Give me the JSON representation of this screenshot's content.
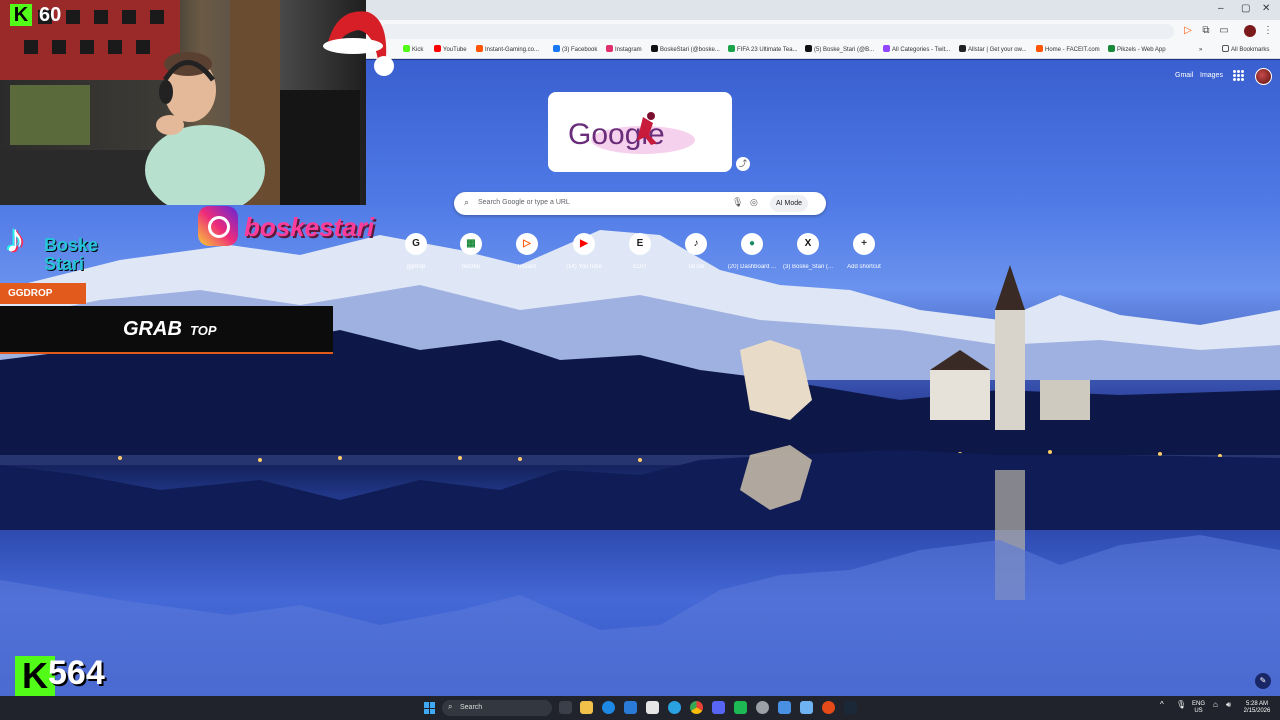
{
  "browser": {
    "bookmarks": [
      {
        "label": "Kick",
        "color": "#53fc18"
      },
      {
        "label": "YouTube",
        "color": "#ff0000"
      },
      {
        "label": "Instant-Gaming.co...",
        "color": "#ff5400"
      },
      {
        "label": "(3) Facebook",
        "color": "#1877f2"
      },
      {
        "label": "Instagram",
        "color": "#e1306c"
      },
      {
        "label": "BoskeStari (@boske...",
        "color": "#111111"
      },
      {
        "label": "FIFA 23 Ultimate Tea...",
        "color": "#1aa34a"
      },
      {
        "label": "(5) Boske_Stari (@B...",
        "color": "#111111"
      },
      {
        "label": "All Categories - Twit...",
        "color": "#9146ff"
      },
      {
        "label": "Allstar | Get your ow...",
        "color": "#222222"
      },
      {
        "label": "Home - FACEIT.com",
        "color": "#ff5500"
      },
      {
        "label": "Pikzels - Web App",
        "color": "#1a8a3a"
      }
    ],
    "all_bookmarks_label": "All Bookmarks"
  },
  "ntp": {
    "gmail_label": "Gmail",
    "images_label": "Images",
    "doodle_text": "Google",
    "search_placeholder": "Search Google or type a URL",
    "ai_mode_label": "AI Mode",
    "shortcuts": [
      {
        "label": "ggdrop",
        "icon": "G",
        "color": "#222222"
      },
      {
        "label": "bet365",
        "icon": "▦",
        "color": "#1a8a3a"
      },
      {
        "label": "Instant",
        "icon": "▷",
        "color": "#ff5400"
      },
      {
        "label": "(14) YouTube",
        "icon": "▶",
        "color": "#ff0000"
      },
      {
        "label": "EDIT",
        "icon": "E",
        "color": "#222222"
      },
      {
        "label": "TikTok",
        "icon": "♪",
        "color": "#111111"
      },
      {
        "label": "(20) Dashboard ...",
        "icon": "●",
        "color": "#1a8a6a"
      },
      {
        "label": "(3) Boske_Stari (...",
        "icon": "X",
        "color": "#111111"
      },
      {
        "label": "Add shortcut",
        "icon": "+",
        "color": "#333333"
      }
    ]
  },
  "overlay": {
    "kick_viewers": "60",
    "tiktok_name_line1": "Boske",
    "tiktok_name_line2": "Stari",
    "instagram_name": "boskestari",
    "ggdrop_label": "GGDROP",
    "grab_label": "GRAB",
    "top_label": "TOP",
    "kick_followers": "564",
    "kick_name": "boskestari"
  },
  "taskbar": {
    "search_label": "Search",
    "lang_line1": "ENG",
    "lang_line2": "US",
    "time": "5:28 AM",
    "date": "2/15/2026"
  }
}
